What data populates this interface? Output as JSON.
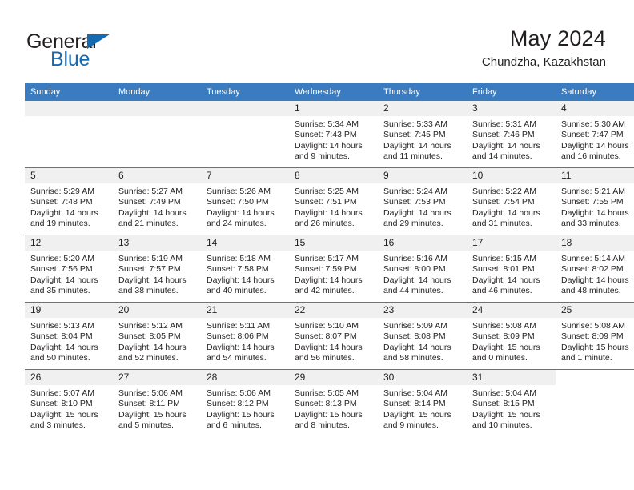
{
  "logo": {
    "word_one": "General",
    "word_two": "Blue",
    "triangle_color": "#156bb1",
    "text_color": "#231f20"
  },
  "header": {
    "title": "May 2024",
    "subtitle": "Chundzha, Kazakhstan"
  },
  "theme": {
    "header_bg": "#3a7cbf",
    "header_text": "#ffffff",
    "daynum_band_bg": "#f0f0f0",
    "row_divider": "#3a7cbf",
    "body_text": "#231f20"
  },
  "calendar": {
    "weekday_headers": [
      "Sunday",
      "Monday",
      "Tuesday",
      "Wednesday",
      "Thursday",
      "Friday",
      "Saturday"
    ],
    "weeks": [
      [
        {
          "day": "",
          "sunrise": "",
          "sunset": "",
          "daylight": "",
          "state": "empty"
        },
        {
          "day": "",
          "sunrise": "",
          "sunset": "",
          "daylight": "",
          "state": "empty"
        },
        {
          "day": "",
          "sunrise": "",
          "sunset": "",
          "daylight": "",
          "state": "empty"
        },
        {
          "day": "1",
          "sunrise": "Sunrise: 5:34 AM",
          "sunset": "Sunset: 7:43 PM",
          "daylight": "Daylight: 14 hours and 9 minutes.",
          "state": "filled"
        },
        {
          "day": "2",
          "sunrise": "Sunrise: 5:33 AM",
          "sunset": "Sunset: 7:45 PM",
          "daylight": "Daylight: 14 hours and 11 minutes.",
          "state": "filled"
        },
        {
          "day": "3",
          "sunrise": "Sunrise: 5:31 AM",
          "sunset": "Sunset: 7:46 PM",
          "daylight": "Daylight: 14 hours and 14 minutes.",
          "state": "filled"
        },
        {
          "day": "4",
          "sunrise": "Sunrise: 5:30 AM",
          "sunset": "Sunset: 7:47 PM",
          "daylight": "Daylight: 14 hours and 16 minutes.",
          "state": "filled"
        }
      ],
      [
        {
          "day": "5",
          "sunrise": "Sunrise: 5:29 AM",
          "sunset": "Sunset: 7:48 PM",
          "daylight": "Daylight: 14 hours and 19 minutes.",
          "state": "filled"
        },
        {
          "day": "6",
          "sunrise": "Sunrise: 5:27 AM",
          "sunset": "Sunset: 7:49 PM",
          "daylight": "Daylight: 14 hours and 21 minutes.",
          "state": "filled"
        },
        {
          "day": "7",
          "sunrise": "Sunrise: 5:26 AM",
          "sunset": "Sunset: 7:50 PM",
          "daylight": "Daylight: 14 hours and 24 minutes.",
          "state": "filled"
        },
        {
          "day": "8",
          "sunrise": "Sunrise: 5:25 AM",
          "sunset": "Sunset: 7:51 PM",
          "daylight": "Daylight: 14 hours and 26 minutes.",
          "state": "filled"
        },
        {
          "day": "9",
          "sunrise": "Sunrise: 5:24 AM",
          "sunset": "Sunset: 7:53 PM",
          "daylight": "Daylight: 14 hours and 29 minutes.",
          "state": "filled"
        },
        {
          "day": "10",
          "sunrise": "Sunrise: 5:22 AM",
          "sunset": "Sunset: 7:54 PM",
          "daylight": "Daylight: 14 hours and 31 minutes.",
          "state": "filled"
        },
        {
          "day": "11",
          "sunrise": "Sunrise: 5:21 AM",
          "sunset": "Sunset: 7:55 PM",
          "daylight": "Daylight: 14 hours and 33 minutes.",
          "state": "filled"
        }
      ],
      [
        {
          "day": "12",
          "sunrise": "Sunrise: 5:20 AM",
          "sunset": "Sunset: 7:56 PM",
          "daylight": "Daylight: 14 hours and 35 minutes.",
          "state": "filled"
        },
        {
          "day": "13",
          "sunrise": "Sunrise: 5:19 AM",
          "sunset": "Sunset: 7:57 PM",
          "daylight": "Daylight: 14 hours and 38 minutes.",
          "state": "filled"
        },
        {
          "day": "14",
          "sunrise": "Sunrise: 5:18 AM",
          "sunset": "Sunset: 7:58 PM",
          "daylight": "Daylight: 14 hours and 40 minutes.",
          "state": "filled"
        },
        {
          "day": "15",
          "sunrise": "Sunrise: 5:17 AM",
          "sunset": "Sunset: 7:59 PM",
          "daylight": "Daylight: 14 hours and 42 minutes.",
          "state": "filled"
        },
        {
          "day": "16",
          "sunrise": "Sunrise: 5:16 AM",
          "sunset": "Sunset: 8:00 PM",
          "daylight": "Daylight: 14 hours and 44 minutes.",
          "state": "filled"
        },
        {
          "day": "17",
          "sunrise": "Sunrise: 5:15 AM",
          "sunset": "Sunset: 8:01 PM",
          "daylight": "Daylight: 14 hours and 46 minutes.",
          "state": "filled"
        },
        {
          "day": "18",
          "sunrise": "Sunrise: 5:14 AM",
          "sunset": "Sunset: 8:02 PM",
          "daylight": "Daylight: 14 hours and 48 minutes.",
          "state": "filled"
        }
      ],
      [
        {
          "day": "19",
          "sunrise": "Sunrise: 5:13 AM",
          "sunset": "Sunset: 8:04 PM",
          "daylight": "Daylight: 14 hours and 50 minutes.",
          "state": "filled"
        },
        {
          "day": "20",
          "sunrise": "Sunrise: 5:12 AM",
          "sunset": "Sunset: 8:05 PM",
          "daylight": "Daylight: 14 hours and 52 minutes.",
          "state": "filled"
        },
        {
          "day": "21",
          "sunrise": "Sunrise: 5:11 AM",
          "sunset": "Sunset: 8:06 PM",
          "daylight": "Daylight: 14 hours and 54 minutes.",
          "state": "filled"
        },
        {
          "day": "22",
          "sunrise": "Sunrise: 5:10 AM",
          "sunset": "Sunset: 8:07 PM",
          "daylight": "Daylight: 14 hours and 56 minutes.",
          "state": "filled"
        },
        {
          "day": "23",
          "sunrise": "Sunrise: 5:09 AM",
          "sunset": "Sunset: 8:08 PM",
          "daylight": "Daylight: 14 hours and 58 minutes.",
          "state": "filled"
        },
        {
          "day": "24",
          "sunrise": "Sunrise: 5:08 AM",
          "sunset": "Sunset: 8:09 PM",
          "daylight": "Daylight: 15 hours and 0 minutes.",
          "state": "filled"
        },
        {
          "day": "25",
          "sunrise": "Sunrise: 5:08 AM",
          "sunset": "Sunset: 8:09 PM",
          "daylight": "Daylight: 15 hours and 1 minute.",
          "state": "filled"
        }
      ],
      [
        {
          "day": "26",
          "sunrise": "Sunrise: 5:07 AM",
          "sunset": "Sunset: 8:10 PM",
          "daylight": "Daylight: 15 hours and 3 minutes.",
          "state": "filled"
        },
        {
          "day": "27",
          "sunrise": "Sunrise: 5:06 AM",
          "sunset": "Sunset: 8:11 PM",
          "daylight": "Daylight: 15 hours and 5 minutes.",
          "state": "filled"
        },
        {
          "day": "28",
          "sunrise": "Sunrise: 5:06 AM",
          "sunset": "Sunset: 8:12 PM",
          "daylight": "Daylight: 15 hours and 6 minutes.",
          "state": "filled"
        },
        {
          "day": "29",
          "sunrise": "Sunrise: 5:05 AM",
          "sunset": "Sunset: 8:13 PM",
          "daylight": "Daylight: 15 hours and 8 minutes.",
          "state": "filled"
        },
        {
          "day": "30",
          "sunrise": "Sunrise: 5:04 AM",
          "sunset": "Sunset: 8:14 PM",
          "daylight": "Daylight: 15 hours and 9 minutes.",
          "state": "filled"
        },
        {
          "day": "31",
          "sunrise": "Sunrise: 5:04 AM",
          "sunset": "Sunset: 8:15 PM",
          "daylight": "Daylight: 15 hours and 10 minutes.",
          "state": "filled"
        },
        {
          "day": "",
          "sunrise": "",
          "sunset": "",
          "daylight": "",
          "state": "blank"
        }
      ]
    ]
  }
}
